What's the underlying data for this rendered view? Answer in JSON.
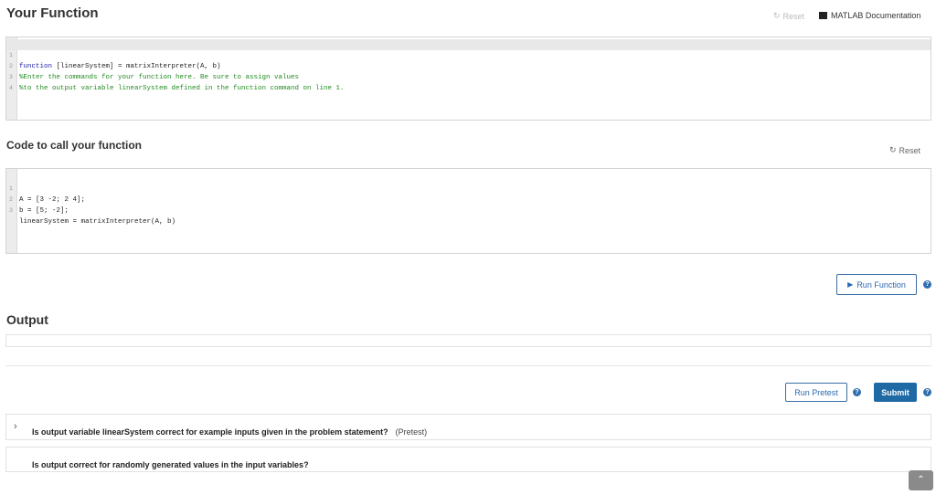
{
  "your_function": {
    "title": "Your Function",
    "reset_label": "Reset",
    "doc_label": "MATLAB Documentation",
    "lines": [
      {
        "num": "1",
        "text": "function [linearSystem] = matrixInterpreter(A, b)"
      },
      {
        "num": "2",
        "text": "%Enter the commands for your function here. Be sure to assign values"
      },
      {
        "num": "3",
        "text": "%to the output variable linearSystem defined in the function command on line 1."
      },
      {
        "num": "4",
        "text": ""
      }
    ]
  },
  "call_function": {
    "title": "Code to call your function",
    "reset_label": "Reset",
    "lines": [
      {
        "num": "1",
        "text": "A = [3 -2; 2 4];"
      },
      {
        "num": "2",
        "text": "b = [5; -2];"
      },
      {
        "num": "3",
        "text": "linearSystem = matrixInterpreter(A, b)"
      }
    ]
  },
  "run_function_label": "Run Function",
  "output": {
    "title": "Output"
  },
  "actions": {
    "run_pretest_label": "Run Pretest",
    "submit_label": "Submit"
  },
  "help_glyph": "?",
  "tests": [
    {
      "text": "Is output variable linearSystem correct for example inputs given in the problem statement?",
      "tag": "(Pretest)"
    },
    {
      "text": "Is output correct for randomly generated values in the input variables?"
    }
  ],
  "colors": {
    "accent": "#1f6aa5",
    "comment": "#228b22",
    "keyword": "#1a1aa6"
  }
}
